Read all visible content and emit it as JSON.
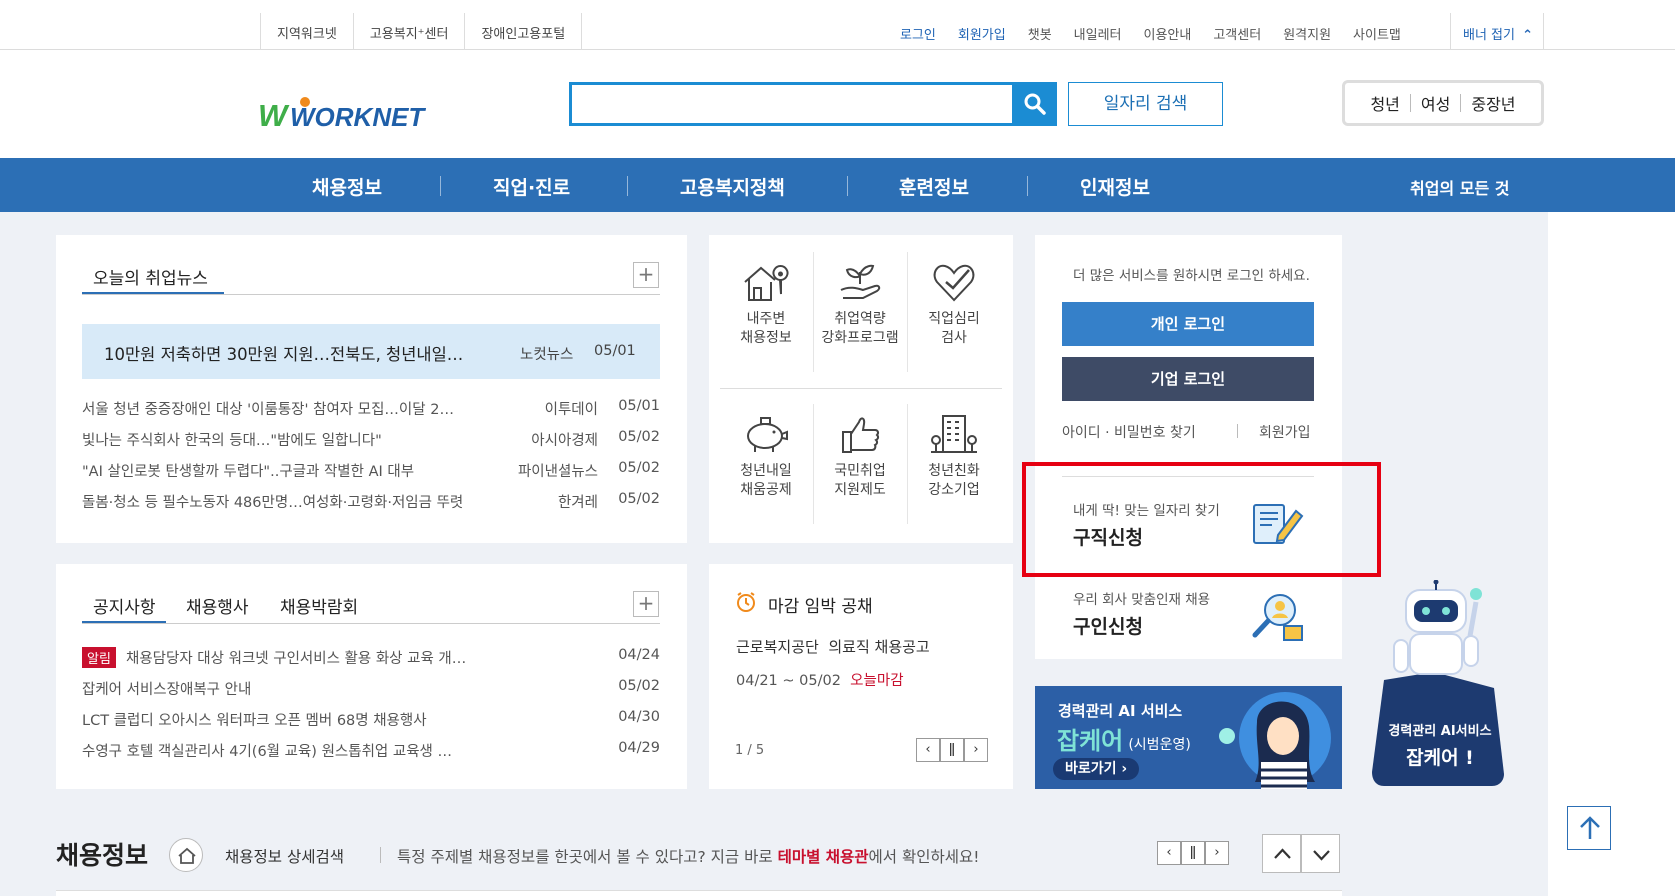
{
  "topbar": {
    "left_links": [
      "지역워크넷",
      "고용복지⁺센터",
      "장애인고용포털"
    ],
    "right_links": [
      {
        "label": "로그인",
        "highlight": true
      },
      {
        "label": "회원가입",
        "highlight": true
      },
      {
        "label": "챗봇",
        "highlight": false
      },
      {
        "label": "내일레터",
        "highlight": false
      },
      {
        "label": "이용안내",
        "highlight": false
      },
      {
        "label": "고객센터",
        "highlight": false
      },
      {
        "label": "원격지원",
        "highlight": false
      },
      {
        "label": "사이트맵",
        "highlight": false
      }
    ],
    "banner_toggle": "배너 접기"
  },
  "header": {
    "logo_text": "WORKNET",
    "search_value": "",
    "job_search_label": "일자리 검색",
    "age_groups": [
      "청년",
      "여성",
      "중장년"
    ]
  },
  "gnb": {
    "items": [
      "채용정보",
      "직업·진로",
      "고용복지정책",
      "훈련정보",
      "인재정보"
    ],
    "all_menu": "취업의 모든 것"
  },
  "news": {
    "tab": "오늘의 취업뉴스",
    "featured": {
      "title": "10만원 저축하면 30만원 지원…전북도, 청년내일…",
      "source": "노컷뉴스",
      "date": "05/01"
    },
    "items": [
      {
        "title": "서울 청년 중증장애인 대상 '이룸통장' 참여자 모집…이달 2…",
        "source": "이투데이",
        "date": "05/01"
      },
      {
        "title": "빛나는 주식회사 한국의 등대…\"밤에도 일합니다\"",
        "source": "아시아경제",
        "date": "05/02"
      },
      {
        "title": "\"AI 살인로봇 탄생할까 두렵다\"..구글과 작별한 AI 대부",
        "source": "파이낸셜뉴스",
        "date": "05/02"
      },
      {
        "title": "돌봄·청소 등 필수노동자 486만명…여성화·고령화·저임금 뚜렷",
        "source": "한겨레",
        "date": "05/02"
      }
    ]
  },
  "quick_menu": [
    {
      "label1": "내주변",
      "label2": "채용정보",
      "icon": "house-location-icon"
    },
    {
      "label1": "취업역량",
      "label2": "강화프로그램",
      "icon": "sprout-hand-icon"
    },
    {
      "label1": "직업심리",
      "label2": "검사",
      "icon": "heart-check-icon"
    },
    {
      "label1": "청년내일",
      "label2": "채움공제",
      "icon": "piggy-bank-icon"
    },
    {
      "label1": "국민취업",
      "label2": "지원제도",
      "icon": "thumbs-up-icon"
    },
    {
      "label1": "청년친화",
      "label2": "강소기업",
      "icon": "building-icon"
    }
  ],
  "login": {
    "notice": "더 많은 서비스를 원하시면 로그인 하세요.",
    "personal": "개인 로그인",
    "company": "기업 로그인",
    "find": "아이디 · 비밀번호 찾기",
    "join": "회원가입"
  },
  "services": {
    "job_seek": {
      "sub": "내게 딱! 맞는 일자리 찾기",
      "main": "구직신청"
    },
    "recruit": {
      "sub": "우리 회사 맞춤인재 채용",
      "main": "구인신청"
    }
  },
  "notices": {
    "tabs": [
      "공지사항",
      "채용행사",
      "채용박람회"
    ],
    "badge": "알림",
    "items": [
      {
        "title": "채용담당자 대상 워크넷 구인서비스 활용 화상 교육 개…",
        "date": "04/24",
        "badge": true
      },
      {
        "title": "잡케어 서비스장애복구 안내",
        "date": "05/02",
        "badge": false
      },
      {
        "title": "LCT 클럽디 오아시스 워터파크 오픈 멤버 68명 채용행사",
        "date": "04/30",
        "badge": false
      },
      {
        "title": "수영구 호텔 객실관리사 4기(6월 교육) 원스톱취업 교육생 …",
        "date": "04/29",
        "badge": false
      }
    ]
  },
  "deadline": {
    "title": "마감 임박 공채",
    "company": "근로복지공단",
    "job": "의료직 채용공고",
    "period": "04/21 ~ 05/02",
    "status": "오늘마감",
    "pager": "1 / 5"
  },
  "ai_banner": {
    "title": "경력관리 AI 서비스",
    "name": "잡케어",
    "suffix": "(시범운영)",
    "cta": "바로가기"
  },
  "robot_banner": {
    "line1": "경력관리 AI서비스",
    "line2": "잡케어 !"
  },
  "jobinfo": {
    "title": "채용정보",
    "detail": "채용정보 상세검색",
    "desc_pre": "특정 주제별 채용정보를 한곳에서 볼 수 있다고? 지금 바로 ",
    "desc_em": "테마별 채용관",
    "desc_post": "에서 확인하세요!"
  },
  "colors": {
    "primary": "#2c6fb5",
    "accent": "#1b8cd3",
    "dark_btn": "#3e4b66",
    "highlight_box": "#e60012",
    "red_text": "#c8102e"
  }
}
